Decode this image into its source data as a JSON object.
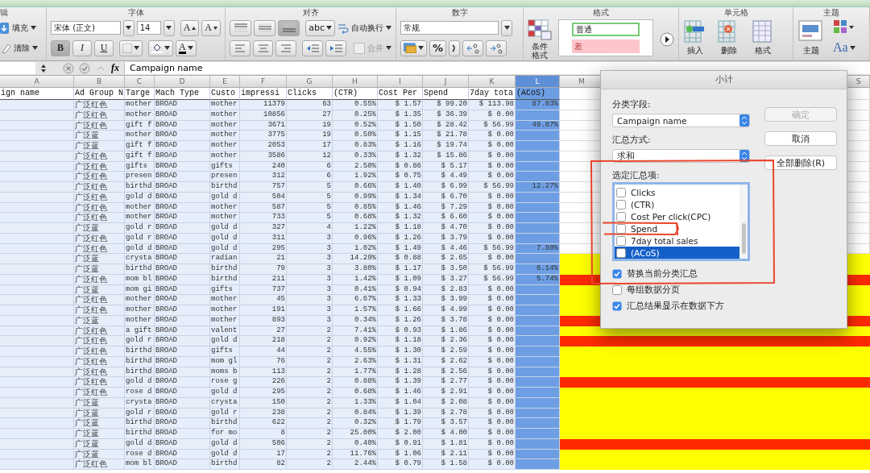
{
  "ribbon": {
    "edit": {
      "label": "辑",
      "fill": "填充",
      "clear": "清除"
    },
    "font": {
      "label": "字体",
      "name": "宋体 (正文)",
      "size": "14",
      "grow": "A",
      "shrink": "A",
      "styles": [
        {
          "label": "B",
          "on": true
        },
        {
          "label": "I",
          "on": false
        },
        {
          "label": "U",
          "on": false
        }
      ],
      "color_button": "A"
    },
    "align": {
      "label": "对齐",
      "vertical": [
        {
          "on": false
        },
        {
          "on": false
        },
        {
          "on": true
        }
      ],
      "orientation": "abc",
      "wrap": "自动换行",
      "merge": {
        "label": "合并",
        "disabled": true
      }
    },
    "number": {
      "label": "数字",
      "format": "常规",
      "percent": "%"
    },
    "styles": {
      "label": "格式",
      "conditional": "条件格式",
      "normal": "普通",
      "bad": "差"
    },
    "cells": {
      "label": "单元格",
      "buttons": [
        "插入",
        "删除",
        "格式"
      ]
    },
    "themes": {
      "label": "主题",
      "themes": "主题",
      "fonts": "Aa"
    }
  },
  "formula_bar": {
    "fx": "fx",
    "content": "Campaign name"
  },
  "sheet": {
    "columns": [
      {
        "letter": "A",
        "header": "ign name",
        "selected": false
      },
      {
        "letter": "B",
        "header": "Ad Group N",
        "selected": false
      },
      {
        "letter": "C",
        "header": "Targe",
        "selected": false
      },
      {
        "letter": "D",
        "header": "Mach Type",
        "selected": false
      },
      {
        "letter": "E",
        "header": "Custo",
        "selected": false
      },
      {
        "letter": "F",
        "header": "impressi",
        "selected": false
      },
      {
        "letter": "G",
        "header": "Clicks",
        "selected": false
      },
      {
        "letter": "H",
        "header": "(CTR)",
        "selected": false
      },
      {
        "letter": "I",
        "header": "Cost Per",
        "selected": false
      },
      {
        "letter": "J",
        "header": "Spend",
        "selected": false
      },
      {
        "letter": "K",
        "header": "7day tota",
        "selected": false
      },
      {
        "letter": "L",
        "header": "(ACoS)",
        "selected": true
      }
    ],
    "more_columns": [
      "M",
      "S"
    ],
    "rows": [
      [
        "",
        "广泛红色",
        "mother",
        "BROAD",
        "mother",
        "11379",
        "63",
        "0.55%",
        "$ 1.57",
        "$ 99.20",
        "$ 113.98",
        "87.03%"
      ],
      [
        "",
        "广泛红色",
        "mother",
        "BROAD",
        "mother",
        "10856",
        "27",
        "0.25%",
        "$ 1.35",
        "$ 36.39",
        "$ 0.00",
        ""
      ],
      [
        "",
        "广泛红色",
        "gift f",
        "BROAD",
        "mother",
        "3671",
        "19",
        "0.52%",
        "$ 1.50",
        "$ 28.42",
        "$ 56.99",
        "49.87%"
      ],
      [
        "",
        "广泛蓝",
        "mother",
        "BROAD",
        "mother",
        "3775",
        "19",
        "0.50%",
        "$ 1.15",
        "$ 21.78",
        "$ 0.00",
        ""
      ],
      [
        "",
        "广泛蓝",
        "gift f",
        "BROAD",
        "mother",
        "2053",
        "17",
        "0.83%",
        "$ 1.16",
        "$ 19.74",
        "$ 0.00",
        ""
      ],
      [
        "",
        "广泛红色",
        "gift f",
        "BROAD",
        "mother",
        "3586",
        "12",
        "0.33%",
        "$ 1.32",
        "$ 15.86",
        "$ 0.00",
        ""
      ],
      [
        "",
        "广泛红色",
        "gifts",
        "BROAD",
        "gifts",
        "240",
        "6",
        "2.50%",
        "$ 0.86",
        "$ 5.17",
        "$ 0.00",
        ""
      ],
      [
        "",
        "广泛红色",
        "presen",
        "BROAD",
        "presen",
        "312",
        "6",
        "1.92%",
        "$ 0.75",
        "$ 4.49",
        "$ 0.00",
        ""
      ],
      [
        "",
        "广泛红色",
        "birthd",
        "BROAD",
        "birthd",
        "757",
        "5",
        "0.66%",
        "$ 1.40",
        "$ 6.99",
        "$ 56.99",
        "12.27%"
      ],
      [
        "",
        "广泛红色",
        "gold d",
        "BROAD",
        "gold d",
        "504",
        "5",
        "0.99%",
        "$ 1.34",
        "$ 6.70",
        "$ 0.00",
        ""
      ],
      [
        "",
        "广泛红色",
        "mother",
        "BROAD",
        "mother",
        "587",
        "5",
        "0.85%",
        "$ 1.46",
        "$ 7.29",
        "$ 0.00",
        ""
      ],
      [
        "",
        "广泛红色",
        "mother",
        "BROAD",
        "mother",
        "733",
        "5",
        "0.68%",
        "$ 1.32",
        "$ 6.60",
        "$ 0.00",
        ""
      ],
      [
        "",
        "广泛蓝",
        "gold r",
        "BROAD",
        "gold d",
        "327",
        "4",
        "1.22%",
        "$ 1.18",
        "$ 4.70",
        "$ 0.00",
        ""
      ],
      [
        "",
        "广泛红色",
        "gold r",
        "BROAD",
        "gold d",
        "311",
        "3",
        "0.96%",
        "$ 1.26",
        "$ 3.79",
        "$ 0.00",
        ""
      ],
      [
        "",
        "广泛红色",
        "gold d",
        "BROAD",
        "gold d",
        "295",
        "3",
        "1.02%",
        "$ 1.49",
        "$ 4.46",
        "$ 56.99",
        "7.80%"
      ],
      [
        "",
        "广泛蓝",
        "crysta",
        "BROAD",
        "radian",
        "21",
        "3",
        "14.29%",
        "$ 0.88",
        "$ 2.65",
        "$ 0.00",
        ""
      ],
      [
        "",
        "广泛蓝",
        "birthd",
        "BROAD",
        "birthd",
        "79",
        "3",
        "3.80%",
        "$ 1.17",
        "$ 3.50",
        "$ 56.99",
        "6.14%"
      ],
      [
        "",
        "广泛红色",
        "mom bl",
        "BROAD",
        "birthd",
        "211",
        "3",
        "1.42%",
        "$ 1.09",
        "$ 3.27",
        "$ 56.99",
        "5.74%"
      ],
      [
        "",
        "广泛蓝",
        "mom gi",
        "BROAD",
        "gifts",
        "737",
        "3",
        "0.41%",
        "$ 0.94",
        "$ 2.83",
        "$ 0.00",
        ""
      ],
      [
        "",
        "广泛红色",
        "mother",
        "BROAD",
        "mother",
        "45",
        "3",
        "6.67%",
        "$ 1.33",
        "$ 3.99",
        "$ 0.00",
        ""
      ],
      [
        "",
        "广泛红色",
        "mother",
        "BROAD",
        "mother",
        "191",
        "3",
        "1.57%",
        "$ 1.66",
        "$ 4.99",
        "$ 0.00",
        ""
      ],
      [
        "",
        "广泛蓝",
        "mother",
        "BROAD",
        "mother",
        "893",
        "3",
        "0.34%",
        "$ 1.26",
        "$ 3.78",
        "$ 0.00",
        ""
      ],
      [
        "",
        "广泛红色",
        "a gift",
        "BROAD",
        "valent",
        "27",
        "2",
        "7.41%",
        "$ 0.93",
        "$ 1.86",
        "$ 0.00",
        ""
      ],
      [
        "",
        "广泛红色",
        "gold r",
        "BROAD",
        "gold d",
        "218",
        "2",
        "0.92%",
        "$ 1.18",
        "$ 2.36",
        "$ 0.00",
        ""
      ],
      [
        "",
        "广泛红色",
        "birthd",
        "BROAD",
        "gifts",
        "44",
        "2",
        "4.55%",
        "$ 1.30",
        "$ 2.59",
        "$ 0.00",
        ""
      ],
      [
        "",
        "广泛红色",
        "birthd",
        "BROAD",
        "mom gl",
        "76",
        "2",
        "2.63%",
        "$ 1.31",
        "$ 2.62",
        "$ 0.00",
        ""
      ],
      [
        "",
        "广泛红色",
        "birthd",
        "BROAD",
        "moms b",
        "113",
        "2",
        "1.77%",
        "$ 1.28",
        "$ 2.56",
        "$ 0.00",
        ""
      ],
      [
        "",
        "广泛红色",
        "gold d",
        "BROAD",
        "rose g",
        "226",
        "2",
        "0.88%",
        "$ 1.39",
        "$ 2.77",
        "$ 0.00",
        ""
      ],
      [
        "",
        "广泛红色",
        "rose d",
        "BROAD",
        "gold d",
        "295",
        "2",
        "0.68%",
        "$ 1.46",
        "$ 2.91",
        "$ 0.00",
        ""
      ],
      [
        "",
        "广泛蓝",
        "crysta",
        "BROAD",
        "crysta",
        "150",
        "2",
        "1.33%",
        "$ 1.04",
        "$ 2.08",
        "$ 0.00",
        ""
      ],
      [
        "",
        "广泛蓝",
        "gold r",
        "BROAD",
        "gold r",
        "238",
        "2",
        "0.84%",
        "$ 1.39",
        "$ 2.78",
        "$ 0.00",
        ""
      ],
      [
        "",
        "广泛蓝",
        "birthd",
        "BROAD",
        "birthd",
        "622",
        "2",
        "0.32%",
        "$ 1.79",
        "$ 3.57",
        "$ 0.00",
        ""
      ],
      [
        "",
        "广泛蓝",
        "birthd",
        "BROAD",
        "for mo",
        "8",
        "2",
        "25.00%",
        "$ 2.00",
        "$ 4.00",
        "$ 0.00",
        ""
      ],
      [
        "",
        "广泛蓝",
        "gold d",
        "BROAD",
        "gold d",
        "506",
        "2",
        "0.40%",
        "$ 0.91",
        "$ 1.81",
        "$ 0.00",
        ""
      ],
      [
        "",
        "广泛蓝",
        "rose d",
        "BROAD",
        "gold d",
        "17",
        "2",
        "11.76%",
        "$ 1.06",
        "$ 2.11",
        "$ 0.00",
        ""
      ],
      [
        "",
        "广泛红色",
        "mom bl",
        "BROAD",
        "birthd",
        "82",
        "2",
        "2.44%",
        "$ 0.79",
        "$ 1.58",
        "$ 0.00",
        ""
      ]
    ]
  },
  "dialog": {
    "title": "小计",
    "field_label": "分类字段:",
    "field_value": "Campaign name",
    "function_label": "汇总方式:",
    "function_value": "求和",
    "items_label": "选定汇总项:",
    "items": [
      {
        "label": "Clicks",
        "checked": false,
        "selected": false
      },
      {
        "label": "(CTR)",
        "checked": false,
        "selected": false
      },
      {
        "label": "Cost Per click(CPC)",
        "checked": false,
        "selected": false
      },
      {
        "label": "Spend",
        "checked": false,
        "selected": false
      },
      {
        "label": "7day total sales",
        "checked": false,
        "selected": false
      },
      {
        "label": "(ACoS)",
        "checked": false,
        "selected": true
      }
    ],
    "options": [
      {
        "label": "替换当前分类汇总",
        "checked": true
      },
      {
        "label": "每组数据分页",
        "checked": false
      },
      {
        "label": "汇总结果显示在数据下方",
        "checked": true
      }
    ],
    "buttons": [
      {
        "label": "确定",
        "disabled": true
      },
      {
        "label": "取消",
        "disabled": false
      },
      {
        "label": "全部删除(R)",
        "disabled": false
      }
    ]
  }
}
